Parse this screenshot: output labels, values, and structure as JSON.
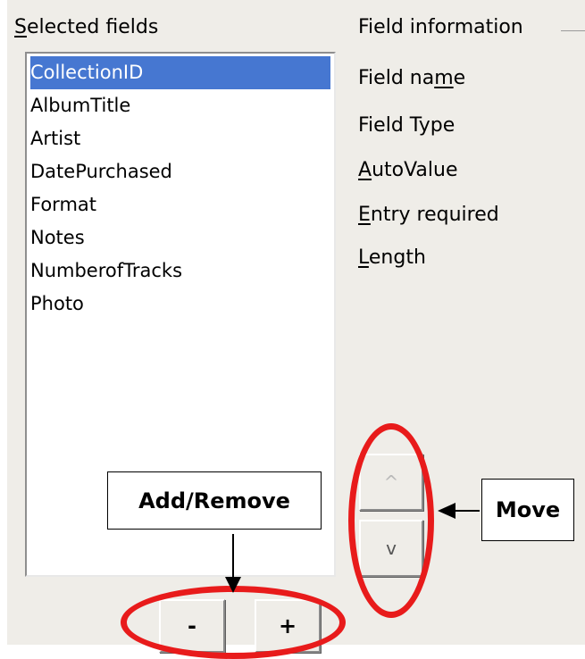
{
  "selected_fields": {
    "label": "Selected fields",
    "items": [
      "CollectionID",
      "AlbumTitle",
      "Artist",
      "DatePurchased",
      "Format",
      "Notes",
      "NumberofTracks",
      "Photo"
    ],
    "selected": "CollectionID"
  },
  "field_information": {
    "title": "Field information",
    "field_name": "Field name",
    "field_type": "Field Type",
    "auto_value": "AutoValue",
    "entry_required": "Entry required",
    "length": "Length"
  },
  "buttons": {
    "move_up": "^",
    "move_down": "v",
    "remove": "-",
    "add": "+"
  },
  "annotations": {
    "add_remove": "Add/Remove",
    "move": "Move",
    "highlight_color": "#e81b1b"
  },
  "colors": {
    "selection": "#4677d1",
    "panel_background": "#efede8"
  }
}
